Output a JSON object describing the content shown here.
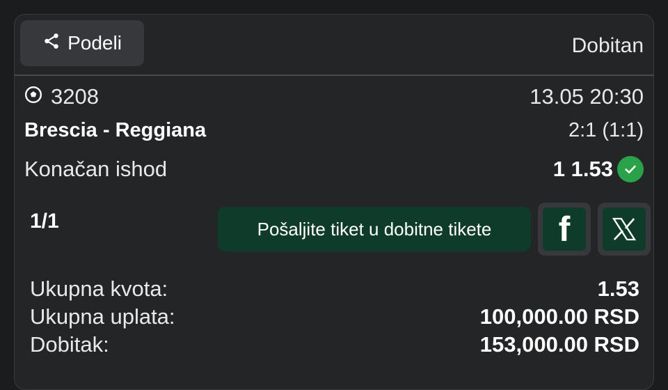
{
  "header": {
    "share_label": "Podeli",
    "status": "Dobitan"
  },
  "match": {
    "event_code": "3208",
    "datetime": "13.05 20:30",
    "teams": "Brescia - Reggiana",
    "score": "2:1 (1:1)",
    "market": "Konačan ishod",
    "pick_odds": "1 1.53",
    "icons": {
      "sport": "football-icon",
      "result": "check-circle-icon"
    },
    "colors": {
      "won": "#2aa24a"
    }
  },
  "ticket": {
    "count": "1/1",
    "send_label": "Pošaljite tiket u dobitne tikete",
    "social": {
      "facebook_icon": "facebook-icon",
      "x_icon": "x-icon"
    },
    "colors": {
      "button_bg": "#0f3b2a"
    }
  },
  "summary": {
    "total_odds_label": "Ukupna kvota:",
    "total_odds_value": "1.53",
    "stake_label": "Ukupna uplata:",
    "stake_value": "100,000.00 RSD",
    "payout_label": "Dobitak:",
    "payout_value": "153,000.00 RSD"
  }
}
